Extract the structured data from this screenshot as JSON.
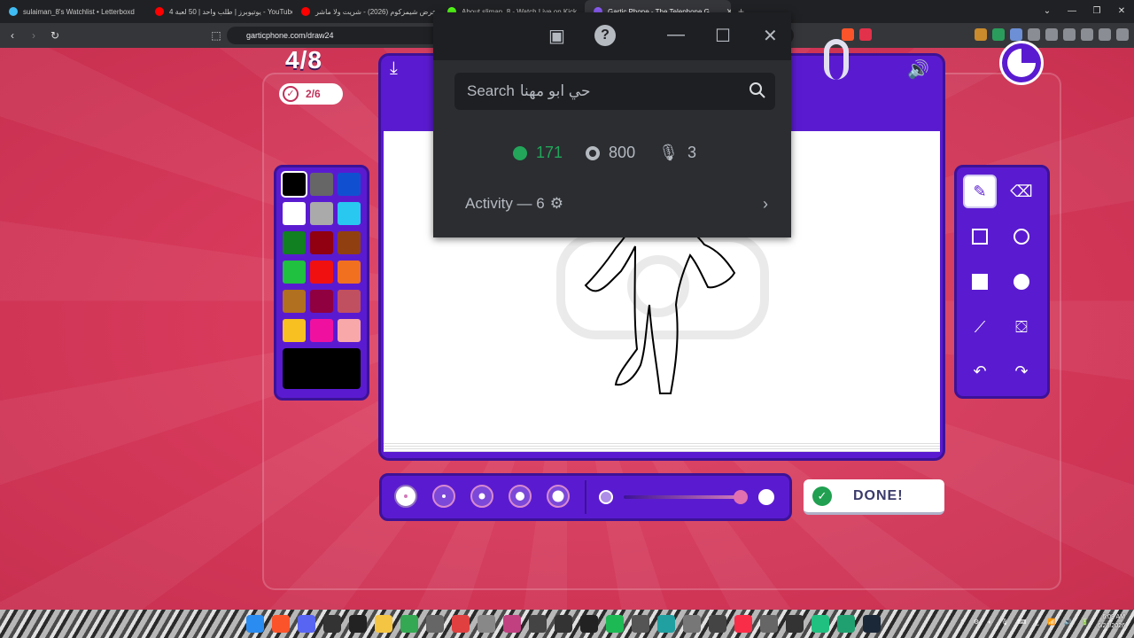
{
  "browser": {
    "tabs": [
      {
        "title": "sulaiman_8's Watchlist • Letterboxd",
        "favicon_color": "#40bcf4"
      },
      {
        "title": "4 يوتيوبرز | طلب واحد | 50 لعبة - YouTube",
        "favicon_color": "#ff0000"
      },
      {
        "title": "عرض شيمزكوم (2026) - شريت ولا ماشر",
        "favicon_color": "#ff0000"
      },
      {
        "title": "About sliman_8 - Watch Live on Kick",
        "favicon_color": "#53fc18"
      },
      {
        "title": "Gartic Phone - The Telephone G...",
        "favicon_color": "#8a5cf5",
        "active": true
      }
    ],
    "new_tab": "+",
    "url": "garticphone.com/draw24"
  },
  "game": {
    "round": "4/8",
    "players_done": "2/6",
    "done_label": "DONE!",
    "timer_elapsed_fraction": 0.25,
    "palette": [
      "#000000",
      "#666666",
      "#1050d0",
      "#ffffff",
      "#aaaaaa",
      "#28c8f0",
      "#108020",
      "#900010",
      "#904010",
      "#20c040",
      "#f01010",
      "#f07020",
      "#b07020",
      "#900040",
      "#c05060",
      "#f8c020",
      "#f010a0",
      "#f8a8a8"
    ],
    "selected_color": "#000000"
  },
  "discord": {
    "search_label": "Search",
    "search_query": "حي ابو مهنا",
    "online_count": "171",
    "member_count": "800",
    "voice_count": "3",
    "activity_label": "Activity — 6"
  },
  "taskbar": {
    "time": "6:09 AM",
    "date": "6/28/2026"
  }
}
